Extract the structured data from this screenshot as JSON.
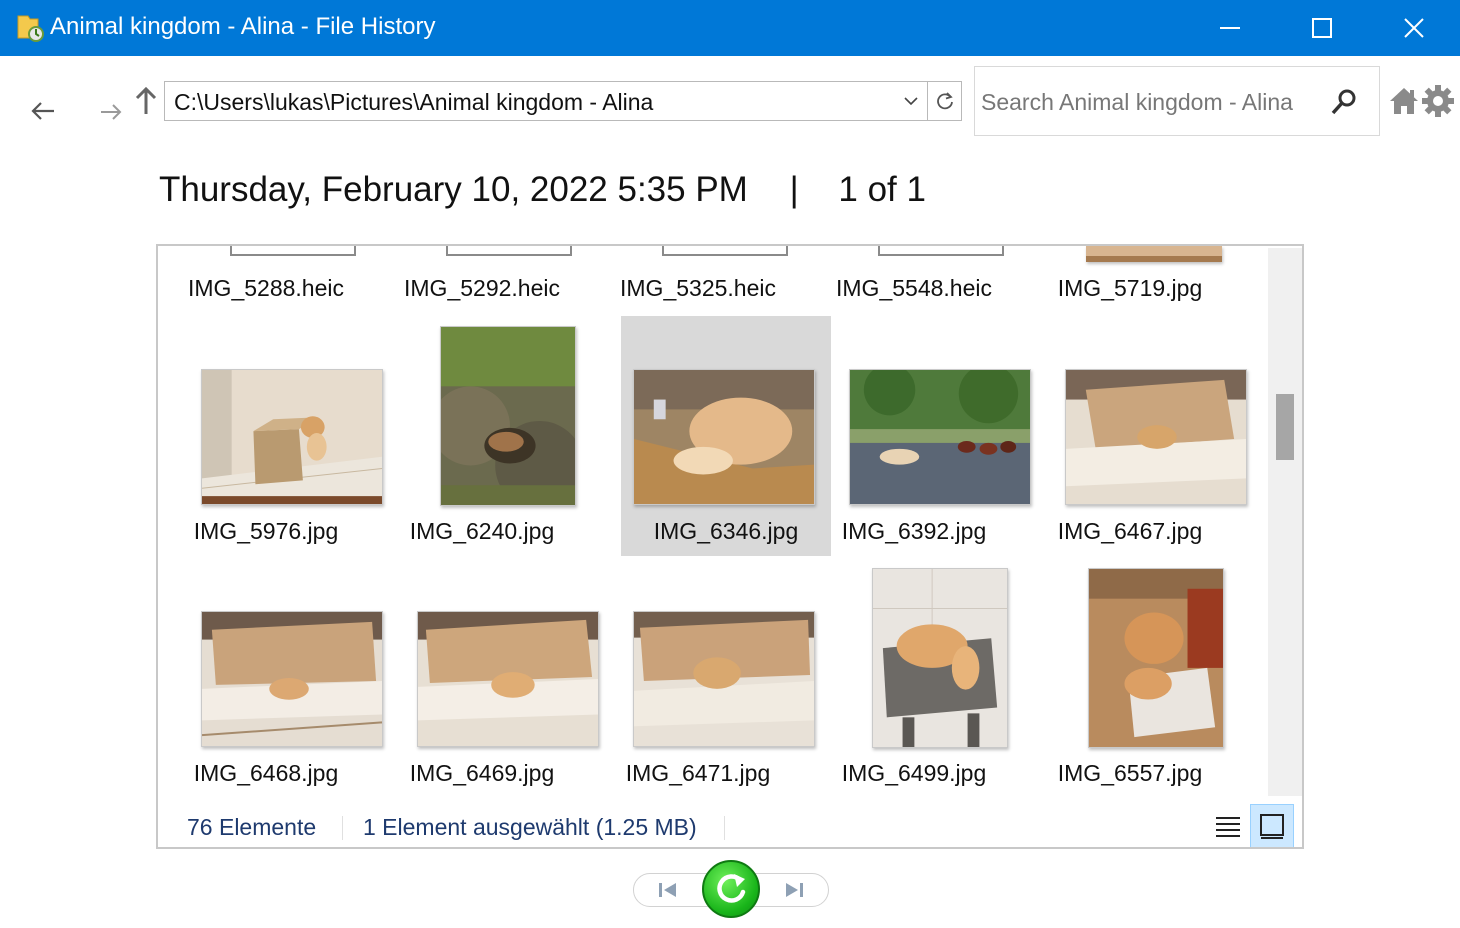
{
  "window": {
    "title": "Animal kingdom - Alina - File History",
    "accent": "#0078d7"
  },
  "nav": {
    "address": "C:\\Users\\lukas\\Pictures\\Animal kingdom - Alina",
    "search_placeholder": "Search Animal kingdom - Alina"
  },
  "header": {
    "date": "Thursday, February 10, 2022 5:35 PM",
    "separator": "|",
    "position": "1 of 1"
  },
  "files": {
    "row1": [
      "IMG_5288.heic",
      "IMG_5292.heic",
      "IMG_5325.heic",
      "IMG_5548.heic",
      "IMG_5719.jpg"
    ],
    "row2": [
      "IMG_5976.jpg",
      "IMG_6240.jpg",
      "IMG_6346.jpg",
      "IMG_6392.jpg",
      "IMG_6467.jpg"
    ],
    "row3": [
      "IMG_6468.jpg",
      "IMG_6469.jpg",
      "IMG_6471.jpg",
      "IMG_6499.jpg",
      "IMG_6557.jpg"
    ],
    "selected": "IMG_6346.jpg"
  },
  "status": {
    "count": "76 Elemente",
    "selection": "1 Element ausgewählt (1.25 MB)"
  },
  "icons": {
    "back": "arrow-left-icon",
    "forward": "arrow-right-icon",
    "up": "arrow-up-icon",
    "home": "home-icon",
    "settings": "gear-icon",
    "restore": "restore-icon",
    "previous": "previous-version-icon",
    "next": "next-version-icon"
  }
}
